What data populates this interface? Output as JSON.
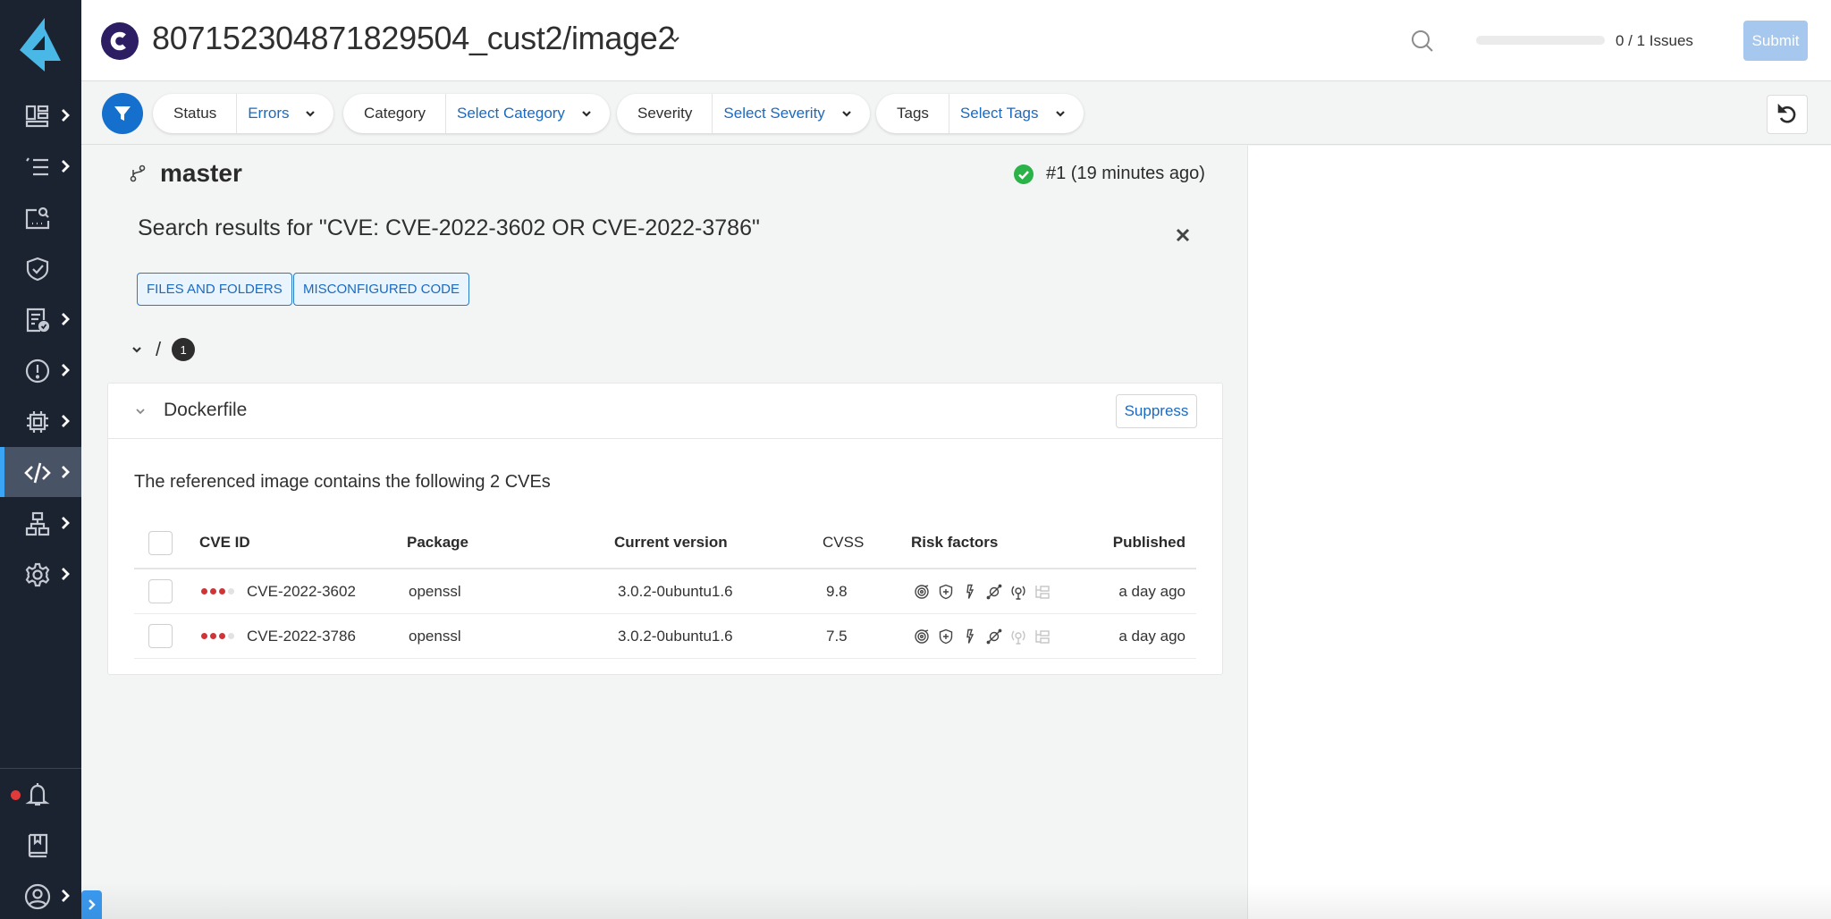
{
  "header": {
    "repo_initial": "C",
    "repo_title": "807152304871829504_cust2/image2",
    "issues_progress_fraction": 0.0,
    "issues_count_text": "0 / 1 Issues",
    "submit_label": "Submit"
  },
  "filters": [
    {
      "label": "Status",
      "value": "Errors"
    },
    {
      "label": "Category",
      "value": "Select Category"
    },
    {
      "label": "Severity",
      "value": "Select Severity"
    },
    {
      "label": "Tags",
      "value": "Select Tags"
    }
  ],
  "sidebar": {
    "items": [
      {
        "icon": "dashboard-icon",
        "has_submenu": true
      },
      {
        "icon": "list-icon",
        "has_submenu": true
      },
      {
        "icon": "search-screen-icon",
        "has_submenu": false
      },
      {
        "icon": "shield-check-icon",
        "has_submenu": false
      },
      {
        "icon": "report-check-icon",
        "has_submenu": true
      },
      {
        "icon": "alert-icon",
        "has_submenu": true
      },
      {
        "icon": "chip-icon",
        "has_submenu": true
      },
      {
        "icon": "code-icon",
        "has_submenu": true,
        "active": true
      },
      {
        "icon": "network-icon",
        "has_submenu": true
      },
      {
        "icon": "gear-icon",
        "has_submenu": true
      }
    ],
    "bottom": [
      {
        "icon": "bell-icon",
        "has_notification": true
      },
      {
        "icon": "book-icon"
      },
      {
        "icon": "user-icon",
        "has_submenu": true
      }
    ],
    "accent_color": "#3aa5f5"
  },
  "main": {
    "branch": "master",
    "scan_status": "#1 (19 minutes ago)",
    "search_heading": "Search results for \"CVE: CVE-2022-3602 OR CVE-2022-3786\"",
    "tags": [
      "FILES AND FOLDERS",
      "MISCONFIGURED CODE"
    ],
    "folder": {
      "path": "/",
      "count": "1"
    },
    "file": {
      "name": "Dockerfile",
      "suppress_label": "Suppress",
      "description": "The referenced image contains the following 2 CVEs",
      "columns": [
        "CVE ID",
        "Package",
        "Current version",
        "CVSS",
        "Risk factors",
        "Published"
      ],
      "rows": [
        {
          "severity_level": 3,
          "severity_max": 4,
          "cve_id": "CVE-2022-3602",
          "package": "openssl",
          "version": "3.0.2-0ubuntu1.6",
          "cvss": "9.8",
          "risk_factors": [
            {
              "name": "attack-complexity-icon",
              "active": true
            },
            {
              "name": "shield-plus-icon",
              "active": true
            },
            {
              "name": "lightning-icon",
              "active": true
            },
            {
              "name": "network-exploit-icon",
              "active": true
            },
            {
              "name": "remote-execution-icon",
              "active": true
            },
            {
              "name": "folders-icon",
              "active": false
            }
          ],
          "published": "a day ago"
        },
        {
          "severity_level": 3,
          "severity_max": 4,
          "cve_id": "CVE-2022-3786",
          "package": "openssl",
          "version": "3.0.2-0ubuntu1.6",
          "cvss": "7.5",
          "risk_factors": [
            {
              "name": "attack-complexity-icon",
              "active": true
            },
            {
              "name": "shield-plus-icon",
              "active": true
            },
            {
              "name": "lightning-icon",
              "active": true
            },
            {
              "name": "network-exploit-icon",
              "active": true
            },
            {
              "name": "remote-execution-icon",
              "active": false
            },
            {
              "name": "folders-icon",
              "active": false
            }
          ],
          "published": "a day ago"
        }
      ]
    }
  },
  "colors": {
    "severity_on": "#d13438",
    "severity_off": "#e2e2e2",
    "link_blue": "#1b6ac0",
    "success_green": "#2bb34a"
  }
}
